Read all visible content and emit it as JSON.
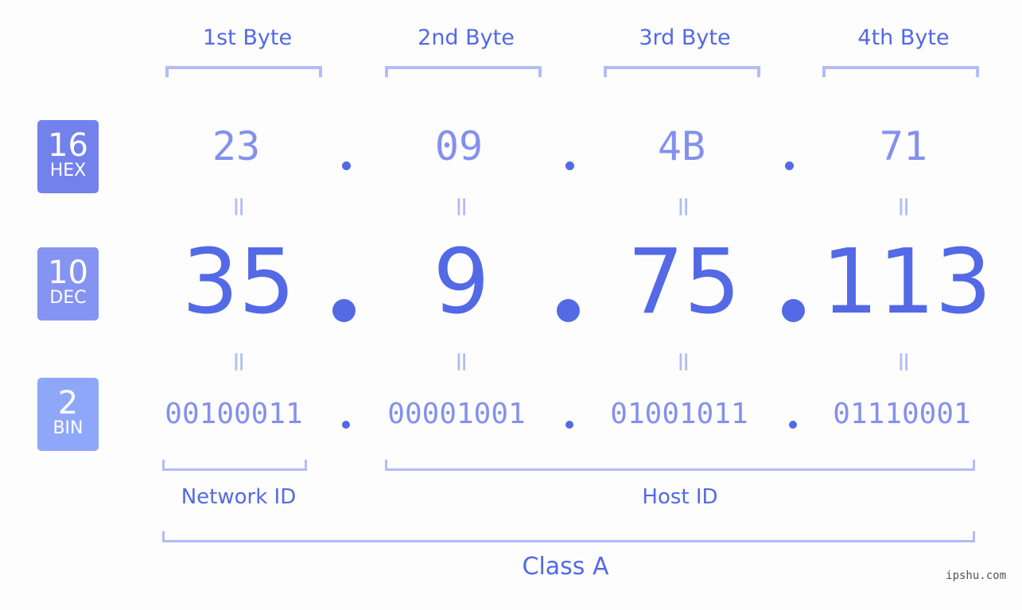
{
  "bytes": {
    "labels": [
      "1st Byte",
      "2nd Byte",
      "3rd Byte",
      "4th Byte"
    ]
  },
  "bases": {
    "hex": {
      "num": "16",
      "label": "HEX",
      "color": "#7281ec"
    },
    "dec": {
      "num": "10",
      "label": "DEC",
      "color": "#8594f2"
    },
    "bin": {
      "num": "2",
      "label": "BIN",
      "color": "#8fa7f9"
    }
  },
  "values": {
    "hex": [
      "23",
      "09",
      "4B",
      "71"
    ],
    "dec": [
      "35",
      "9",
      "75",
      "113"
    ],
    "bin": [
      "00100011",
      "00001001",
      "01001011",
      "01110001"
    ]
  },
  "equals_symbol": "=",
  "segments": {
    "network": "Network ID",
    "host": "Host ID",
    "class": "Class A"
  },
  "watermark": "ipshu.com",
  "colors": {
    "accent": "#5369e6",
    "light": "#8490ee",
    "bracket": "#b2bcf7"
  }
}
